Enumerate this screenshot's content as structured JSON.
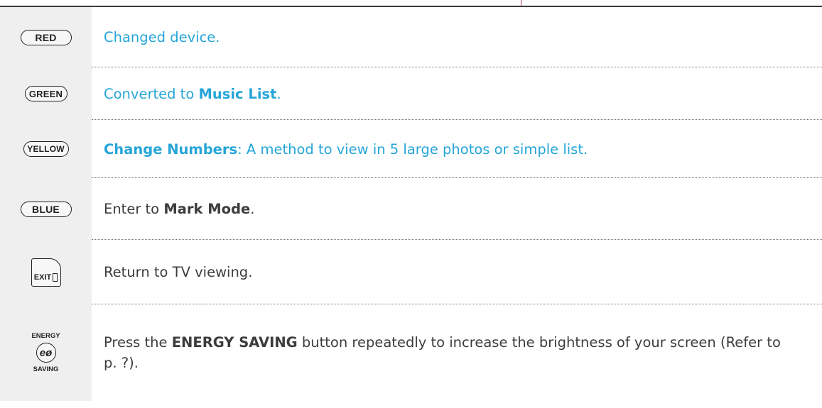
{
  "rows": [
    {
      "key": {
        "type": "pill",
        "label": "RED"
      },
      "desc": {
        "style": "blue",
        "pre": "Changed device.",
        "bold": "",
        "post": ""
      }
    },
    {
      "key": {
        "type": "pill",
        "label": "GREEN"
      },
      "desc": {
        "style": "blue",
        "pre": "Converted to ",
        "bold": "Music List",
        "post": "."
      }
    },
    {
      "key": {
        "type": "pill",
        "label": "YELLOW"
      },
      "desc": {
        "style": "blue",
        "pre": "",
        "bold": "Change Numbers",
        "post": ": A method to view in 5 large photos or simple list."
      }
    },
    {
      "key": {
        "type": "pill",
        "label": "BLUE"
      },
      "desc": {
        "style": "dark",
        "pre": "Enter to ",
        "bold": "Mark Mode",
        "post": "."
      }
    },
    {
      "key": {
        "type": "exit",
        "label": "EXIT"
      },
      "desc": {
        "style": "dark",
        "pre": "Return to TV viewing.",
        "bold": "",
        "post": ""
      }
    },
    {
      "key": {
        "type": "energy",
        "label_top": "ENERGY",
        "glyph": "eø",
        "label_bottom": "SAVING"
      },
      "desc": {
        "style": "dark",
        "pre": "Press the ",
        "bold": "ENERGY SAVING",
        "post": " button repeatedly to increase the brightness of your screen (Refer to p. ?)."
      }
    }
  ],
  "colors": {
    "accent_blue": "#25a5d8",
    "text_dark": "#3c3c3c",
    "key_bg": "#efefef",
    "tick": "#c0395a"
  }
}
